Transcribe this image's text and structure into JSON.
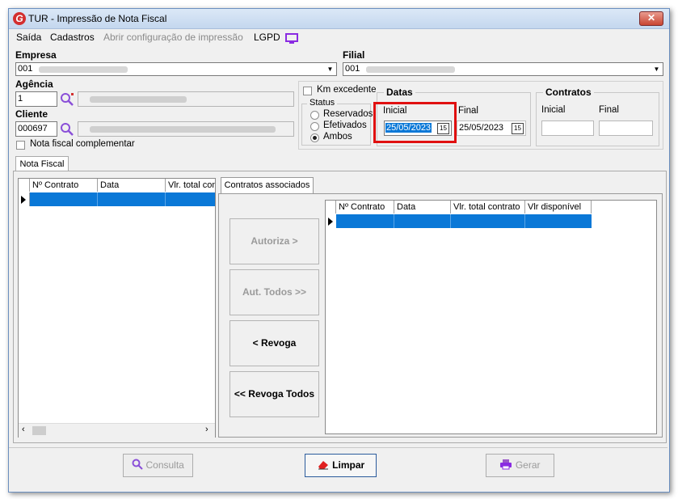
{
  "window": {
    "title": "TUR - Impressão de Nota Fiscal",
    "close_icon": "close-icon"
  },
  "menu": {
    "saida": "Saída",
    "cadastros": "Cadastros",
    "abrir_config": "Abrir configuração de impressão",
    "lgpd": "LGPD"
  },
  "empresa": {
    "label": "Empresa",
    "value": "001"
  },
  "filial": {
    "label": "Filial",
    "value": "001"
  },
  "agencia": {
    "label": "Agência",
    "value": "1"
  },
  "cliente": {
    "label": "Cliente",
    "value": "000697"
  },
  "nota_complementar": {
    "label": "Nota fiscal complementar",
    "checked": false
  },
  "km_excedente": {
    "label": "Km excedente",
    "checked": false
  },
  "status": {
    "title": "Status",
    "options": [
      "Reservados",
      "Efetivados",
      "Ambos"
    ],
    "selected": "Ambos"
  },
  "datas": {
    "title": "Datas",
    "inicial_label": "Inicial",
    "inicial_value": "25/05/2023",
    "final_label": "Final",
    "final_value": "25/05/2023",
    "cal_glyph": "15"
  },
  "contratos": {
    "title": "Contratos",
    "inicial_label": "Inicial",
    "inicial_value": "",
    "final_label": "Final",
    "final_value": ""
  },
  "tabs": {
    "nota_fiscal": "Nota Fiscal",
    "contratos_associados": "Contratos associados"
  },
  "left_grid": {
    "columns": [
      "Nº Contrato",
      "Data",
      "Vlr. total contrato"
    ]
  },
  "right_grid": {
    "columns": [
      "Nº Contrato",
      "Data",
      "Vlr. total contrato",
      "Vlr disponível"
    ]
  },
  "buttons": {
    "autoriza": "Autoriza >",
    "aut_todos": "Aut. Todos >>",
    "revoga": "< Revoga",
    "revoga_todos": "<< Revoga Todos",
    "consulta": "Consulta",
    "limpar": "Limpar",
    "gerar": "Gerar"
  },
  "colors": {
    "selection": "#0a78d7",
    "highlight_box": "#e01010",
    "title_bar": "#c4d7ee"
  }
}
